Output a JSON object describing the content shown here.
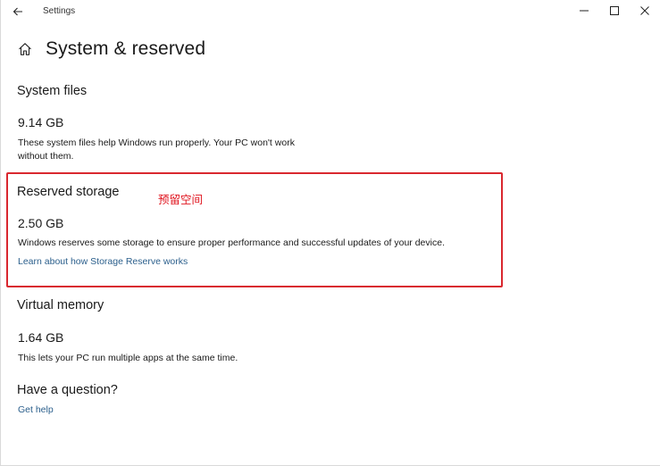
{
  "titlebar": {
    "app_title": "Settings"
  },
  "page": {
    "title": "System & reserved"
  },
  "system_files": {
    "heading": "System files",
    "size": "9.14 GB",
    "description_line1": "These system files help Windows run properly. Your PC won't work",
    "description_line2": "without them."
  },
  "reserved_storage": {
    "heading": "Reserved storage",
    "annotation": "预留空间",
    "size": "2.50 GB",
    "description": "Windows reserves some storage to ensure proper performance and successful updates of your device.",
    "link": "Learn about how Storage Reserve works"
  },
  "virtual_memory": {
    "heading": "Virtual memory",
    "size": "1.64 GB",
    "description": "This lets your PC run multiple apps at the same time."
  },
  "question": {
    "heading": "Have a question?",
    "link": "Get help"
  },
  "colors": {
    "highlight": "#d9282f",
    "annotation": "#e0141e",
    "link": "#2b5f8c"
  },
  "icons": {
    "back": "back-arrow-icon",
    "home": "home-icon",
    "minimize": "minimize-icon",
    "maximize": "maximize-icon",
    "close": "close-icon"
  }
}
